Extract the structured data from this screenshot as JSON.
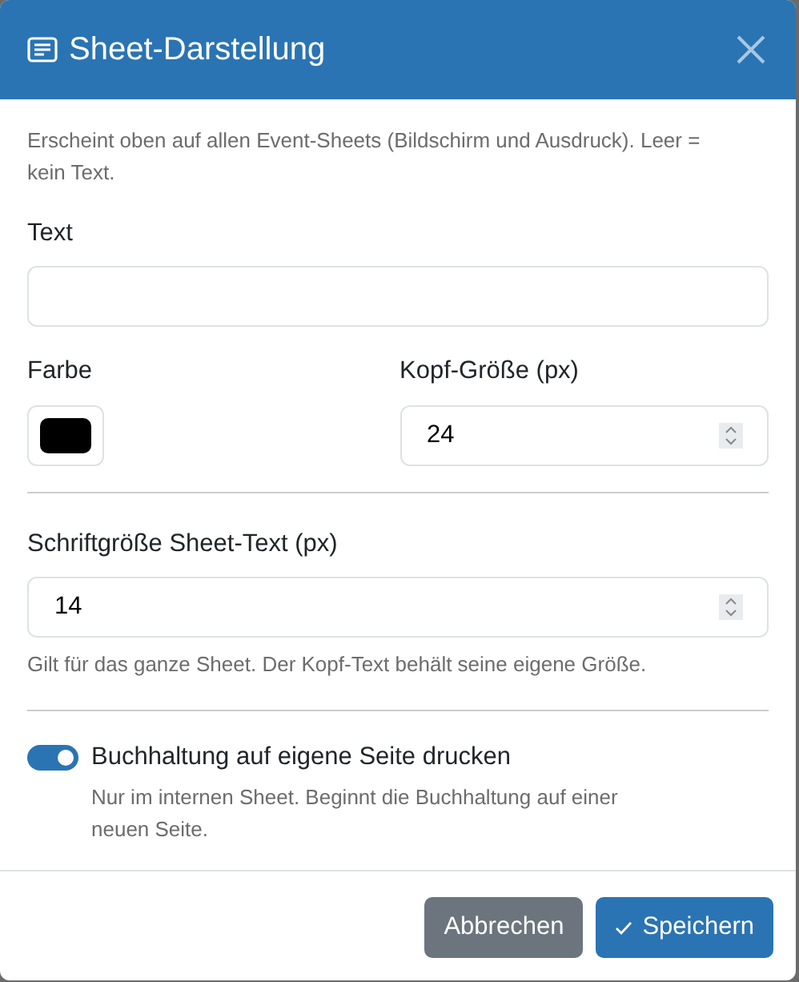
{
  "dialog": {
    "title": "Sheet-Darstellung",
    "description": "Erscheint oben auf allen Event-Sheets (Bildschirm und Ausdruck). Leer = kein Text."
  },
  "text_field": {
    "label": "Text"
  },
  "color_field": {
    "label": "Farbe",
    "color": "#000000"
  },
  "header_size_field": {
    "label": "Kopf-Größe (px)",
    "value": "24"
  },
  "sheet_font_size_field": {
    "label": "Schriftgröße Sheet-Text (px)",
    "value": "14",
    "help": "Gilt für das ganze Sheet. Der Kopf-Text behält seine eigene Größe."
  },
  "accounting_switch": {
    "label": "Buchhaltung auf eigene Seite drucken",
    "on": true,
    "help": "Nur im internen Sheet. Beginnt die Buchhaltung auf einer neuen Seite."
  },
  "buttons": [
    {
      "label": "Abbrechen",
      "kind": "secondary"
    },
    {
      "label": "Speichern",
      "kind": "primary"
    }
  ]
}
